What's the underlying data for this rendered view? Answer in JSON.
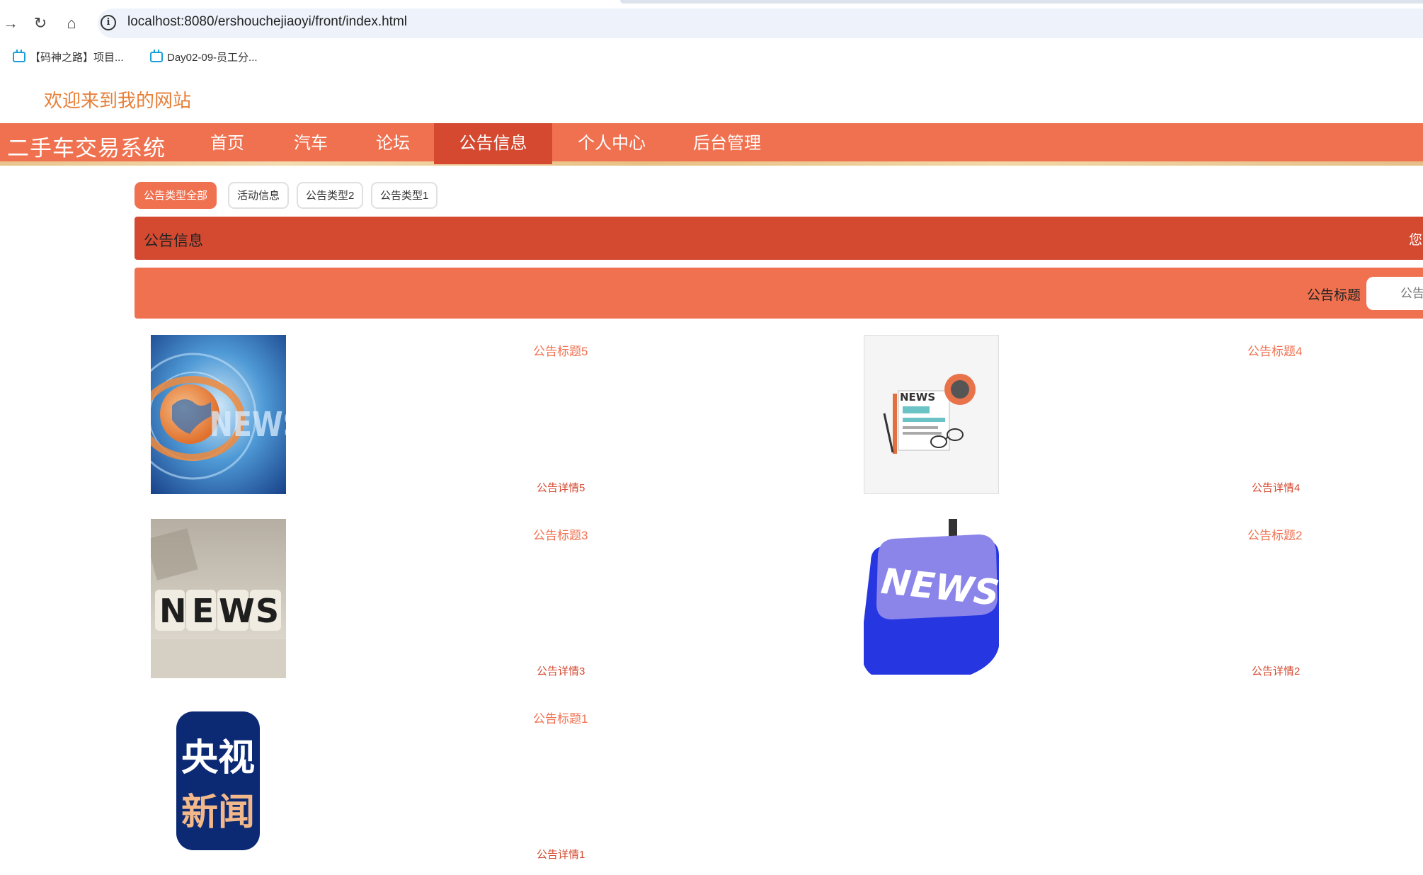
{
  "browser": {
    "url": "localhost:8080/ershouchejiaoyi/front/index.html",
    "bookmarks": [
      {
        "label": "【码神之路】项目..."
      },
      {
        "label": "Day02-09-员工分..."
      }
    ]
  },
  "site": {
    "welcome": "欢迎来到我的网站",
    "title": "二手车交易系统",
    "nav": [
      "首页",
      "汽车",
      "论坛",
      "公告信息",
      "个人中心",
      "后台管理"
    ],
    "active_nav": "公告信息"
  },
  "filters": [
    "公告类型全部",
    "活动信息",
    "公告类型2",
    "公告类型1"
  ],
  "section": {
    "title": "公告信息",
    "right_text": "您"
  },
  "search": {
    "label": "公告标题",
    "placeholder": "公告"
  },
  "notices": [
    {
      "title": "公告标题5",
      "detail": "公告详情5",
      "image": "globe-news-image"
    },
    {
      "title": "公告标题4",
      "detail": "公告详情4",
      "image": "newspaper-illustration-image"
    },
    {
      "title": "公告标题3",
      "detail": "公告详情3",
      "image": "news-blocks-image"
    },
    {
      "title": "公告标题2",
      "detail": "公告详情2",
      "image": "news-key-image"
    },
    {
      "title": "公告标题1",
      "detail": "公告详情1",
      "image": "cctv-news-logo-image",
      "logo_text": [
        "央视",
        "新闻"
      ]
    }
  ],
  "colors": {
    "nav_bg": "#f07150",
    "nav_active": "#d44930",
    "section_bg": "#d44a31",
    "welcome": "#e6803a"
  }
}
